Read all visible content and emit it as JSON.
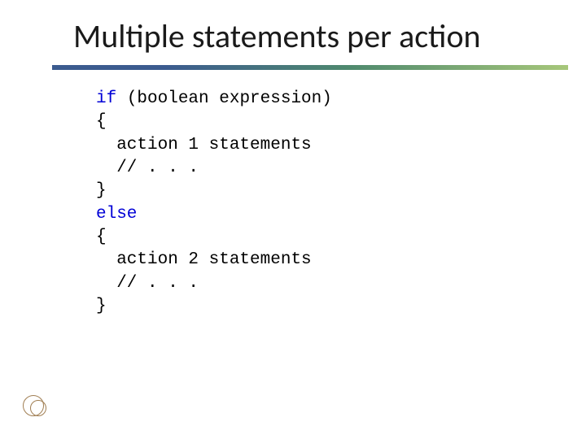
{
  "title": "Multiple statements per action",
  "code": {
    "l1_kw": "if",
    "l1_rest": " (boolean expression)",
    "l2": "{",
    "l3": "  action 1 statements",
    "l4": "  // . . .",
    "l5": "}",
    "l6_kw": "else",
    "l7": "{",
    "l8": "  action 2 statements",
    "l9": "  // . . .",
    "l10": "}"
  }
}
